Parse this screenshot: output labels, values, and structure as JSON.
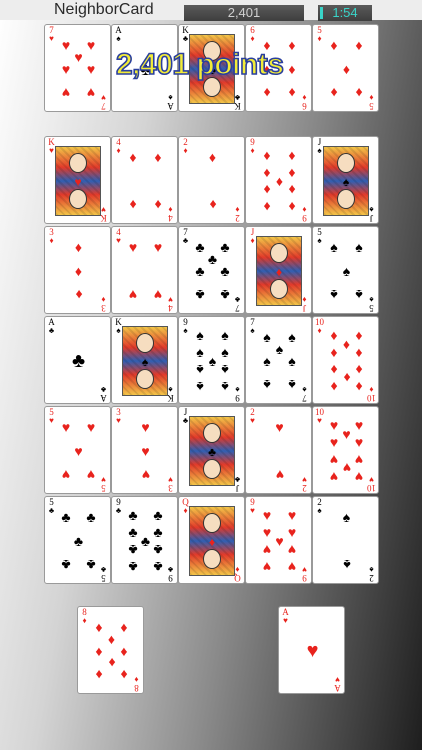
{
  "header": {
    "app_title": "NeighborCard",
    "score": "2,401",
    "timer": "1:54"
  },
  "overlay": {
    "points_text": "2,401 points"
  },
  "top_row": [
    {
      "rank": "7",
      "suit": "heart",
      "symbol": "♥",
      "color": "red"
    },
    {
      "rank": "A",
      "suit": "spade",
      "symbol": "♠",
      "color": "black"
    },
    {
      "rank": "K",
      "suit": "club",
      "symbol": "♣",
      "color": "black"
    },
    {
      "rank": "6",
      "suit": "diamond",
      "symbol": "♦",
      "color": "red"
    },
    {
      "rank": "5",
      "suit": "diamond",
      "symbol": "♦",
      "color": "red"
    }
  ],
  "grid": [
    [
      {
        "rank": "K",
        "suit": "heart",
        "symbol": "♥",
        "color": "red"
      },
      {
        "rank": "4",
        "suit": "diamond",
        "symbol": "♦",
        "color": "red"
      },
      {
        "rank": "2",
        "suit": "diamond",
        "symbol": "♦",
        "color": "red"
      },
      {
        "rank": "9",
        "suit": "diamond",
        "symbol": "♦",
        "color": "red"
      },
      {
        "rank": "J",
        "suit": "spade",
        "symbol": "♠",
        "color": "black"
      }
    ],
    [
      {
        "rank": "3",
        "suit": "diamond",
        "symbol": "♦",
        "color": "red"
      },
      {
        "rank": "4",
        "suit": "heart",
        "symbol": "♥",
        "color": "red"
      },
      {
        "rank": "7",
        "suit": "club",
        "symbol": "♣",
        "color": "black"
      },
      {
        "rank": "J",
        "suit": "diamond",
        "symbol": "♦",
        "color": "red"
      },
      {
        "rank": "5",
        "suit": "spade",
        "symbol": "♠",
        "color": "black"
      }
    ],
    [
      {
        "rank": "A",
        "suit": "club",
        "symbol": "♣",
        "color": "black"
      },
      {
        "rank": "K",
        "suit": "spade",
        "symbol": "♠",
        "color": "black"
      },
      {
        "rank": "9",
        "suit": "spade",
        "symbol": "♠",
        "color": "black"
      },
      {
        "rank": "7",
        "suit": "spade",
        "symbol": "♠",
        "color": "black"
      },
      {
        "rank": "10",
        "suit": "diamond",
        "symbol": "♦",
        "color": "red"
      }
    ],
    [
      {
        "rank": "5",
        "suit": "heart",
        "symbol": "♥",
        "color": "red"
      },
      {
        "rank": "3",
        "suit": "heart",
        "symbol": "♥",
        "color": "red"
      },
      {
        "rank": "J",
        "suit": "club",
        "symbol": "♣",
        "color": "black"
      },
      {
        "rank": "2",
        "suit": "heart",
        "symbol": "♥",
        "color": "red"
      },
      {
        "rank": "10",
        "suit": "heart",
        "symbol": "♥",
        "color": "red"
      }
    ],
    [
      {
        "rank": "5",
        "suit": "club",
        "symbol": "♣",
        "color": "black"
      },
      {
        "rank": "9",
        "suit": "club",
        "symbol": "♣",
        "color": "black"
      },
      {
        "rank": "Q",
        "suit": "diamond",
        "symbol": "♦",
        "color": "red"
      },
      {
        "rank": "9",
        "suit": "heart",
        "symbol": "♥",
        "color": "red"
      },
      {
        "rank": "2",
        "suit": "spade",
        "symbol": "♠",
        "color": "black"
      }
    ]
  ],
  "bottom_cards": {
    "left": {
      "rank": "8",
      "suit": "diamond",
      "symbol": "♦",
      "color": "red"
    },
    "right": {
      "rank": "A",
      "suit": "heart",
      "symbol": "♥",
      "color": "red"
    }
  },
  "colors": {
    "red_suit": "#e8231d",
    "black_suit": "#000000",
    "timer_text": "#39d4c8",
    "points_fill": "#f2ec38",
    "points_outline": "#2a3f9e"
  }
}
